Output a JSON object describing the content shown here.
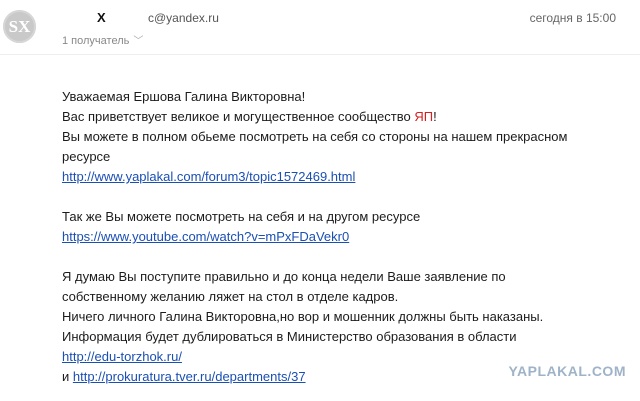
{
  "header": {
    "avatar_text": "SX",
    "sender_name": "X",
    "sender_email": "c@yandex.ru",
    "time": "сегодня в 15:00",
    "recipients": "1 получатель"
  },
  "message": {
    "greeting": "Уважаемая Ершова Галина Викторовна!",
    "line2_before": "Вас приветствует великое и могущественное сообщество ",
    "line2_highlight": "ЯП",
    "line2_after": "!",
    "line3": "Вы можете в полном обьеме посмотреть на себя со стороны на нашем прекрасном",
    "line4": "ресурсе",
    "link1": "http://www.yaplakal.com/forum3/topic1572469.html",
    "line6": "Так же Вы можете посмотреть на себя и на другом ресурсе",
    "link2": "https://www.youtube.com/watch?v=mPxFDaVekr0",
    "line8": "Я думаю Вы поступите правильно и до конца недели Ваше заявление по",
    "line9": "собственному желанию ляжет на стол в отделе кадров.",
    "line10": "Ничего личного Галина Викторовна,но вор и мошенник должны быть наказаны.",
    "line11": "Информация будет дублироваться в Министерство образования в области",
    "link3": "http://edu-torzhok.ru/",
    "line13_prefix": "и ",
    "link4": "http://prokuratura.tver.ru/departments/37"
  },
  "watermark": "YAPLAKAL.COM",
  "colors": {
    "link": "#1a4fb4",
    "highlight": "#d42020",
    "watermark": "#9fb3c8"
  }
}
